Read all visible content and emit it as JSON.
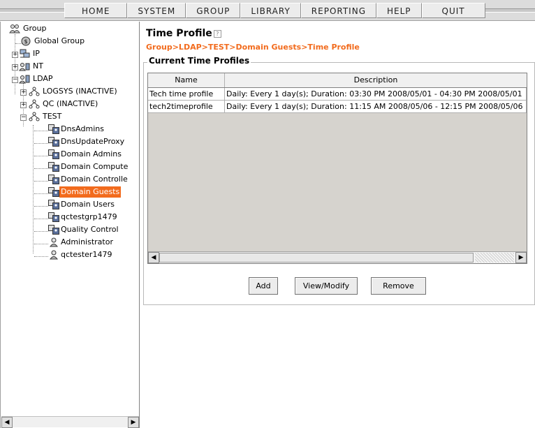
{
  "menu": {
    "items": [
      "HOME",
      "SYSTEM",
      "GROUP",
      "LIBRARY",
      "REPORTING",
      "HELP",
      "QUIT"
    ]
  },
  "tree": {
    "root": "Group",
    "global": "Global Group",
    "ip": "IP",
    "nt": "NT",
    "ldap": "LDAP",
    "logsys": "LOGSYS (INACTIVE)",
    "qc": "QC (INACTIVE)",
    "test": "TEST",
    "children": [
      "DnsAdmins",
      "DnsUpdateProxy",
      "Domain Admins",
      "Domain Compute",
      "Domain Controlle",
      "Domain Guests",
      "Domain Users",
      "qctestgrp1479",
      "Quality Control",
      "Administrator",
      "qctester1479"
    ],
    "selected": "Domain Guests"
  },
  "page": {
    "title": "Time Profile",
    "breadcrumb": "Group>LDAP>TEST>Domain Guests>Time Profile",
    "section": "Current Time Profiles"
  },
  "table": {
    "headers": [
      "Name",
      "Description"
    ],
    "rows": [
      [
        "Tech time profile",
        "Daily: Every 1 day(s); Duration: 03:30 PM 2008/05/01 - 04:30 PM 2008/05/01"
      ],
      [
        "tech2timeprofile",
        "Daily: Every 1 day(s); Duration: 11:15 AM 2008/05/06 - 12:15 PM 2008/05/06"
      ]
    ]
  },
  "buttons": {
    "add": "Add",
    "view_modify": "View/Modify",
    "remove": "Remove"
  },
  "colors": {
    "accent": "#f26b1d",
    "panel_bg": "#d6d3ce"
  }
}
